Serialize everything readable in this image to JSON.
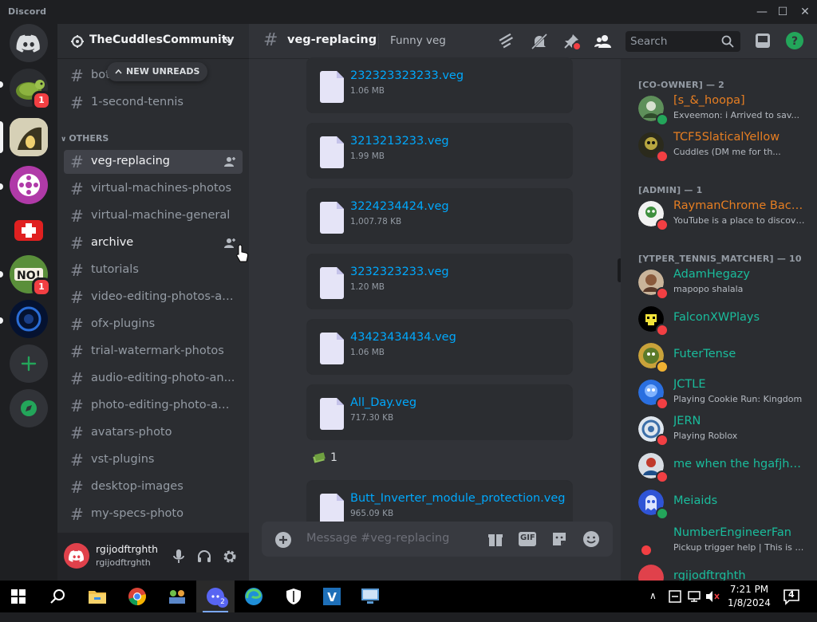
{
  "app": {
    "title": "Discord"
  },
  "window_controls": {
    "minimize": "—",
    "maximize": "☐",
    "close": "✕"
  },
  "servers": [
    {
      "name": "turtle-server",
      "badge": "1"
    },
    {
      "name": "selected-server"
    },
    {
      "name": "video-server"
    },
    {
      "name": "red-server"
    },
    {
      "name": "no-server",
      "badge": "1"
    },
    {
      "name": "space-server"
    }
  ],
  "guild": {
    "name": "TheCuddlesCommunity"
  },
  "new_unreads": "NEW UNREADS",
  "channels_top": [
    {
      "name": "bot"
    },
    {
      "name": "1-second-tennis"
    }
  ],
  "category_others": "OTHERS",
  "channels": [
    {
      "name": "veg-replacing"
    },
    {
      "name": "virtual-machines-photos"
    },
    {
      "name": "virtual-machine-general"
    },
    {
      "name": "archive"
    },
    {
      "name": "tutorials"
    },
    {
      "name": "video-editing-photos-an..."
    },
    {
      "name": "ofx-plugins"
    },
    {
      "name": "trial-watermark-photos"
    },
    {
      "name": "audio-editing-photo-an..."
    },
    {
      "name": "photo-editing-photo-an..."
    },
    {
      "name": "avatars-photo"
    },
    {
      "name": "vst-plugins"
    },
    {
      "name": "desktop-images"
    },
    {
      "name": "my-specs-photo"
    }
  ],
  "user": {
    "display": "rgijodftrghth",
    "username": "rgijodftrghth"
  },
  "chat_header": {
    "channel": "veg-replacing",
    "topic": "Funny veg",
    "search_placeholder": "Search"
  },
  "files": [
    {
      "name": "232323323233.veg",
      "size": "1.06 MB"
    },
    {
      "name": "3213213233.veg",
      "size": "1.99 MB"
    },
    {
      "name": "3224234424.veg",
      "size": "1,007.78 KB"
    },
    {
      "name": "3232323233.veg",
      "size": "1.20 MB"
    },
    {
      "name": "43423434434.veg",
      "size": "1.06 MB"
    },
    {
      "name": "All_Day.veg",
      "size": "717.30 KB"
    },
    {
      "name": "Butt_Inverter_module_protection.veg",
      "size": "965.09 KB"
    }
  ],
  "reaction": {
    "count": "1"
  },
  "composer": {
    "placeholder": "Message #veg-replacing",
    "gif": "GIF"
  },
  "member_groups": [
    {
      "title": "[CO-OWNER] — 2"
    },
    {
      "title": "[ADMIN] — 1"
    },
    {
      "title": "[YTPER_TENNIS_MATCHER] — 10"
    }
  ],
  "members": [
    {
      "name": "[s_&_hoopa]",
      "sub": "Exveemon: i Arrived to sav...",
      "color": "#e67e22"
    },
    {
      "name": "TCF5SlaticalYellow",
      "sub": "Cuddles (DM me for th...",
      "color": "#e67e22"
    },
    {
      "name": "RaymanChrome Back...",
      "sub": "YouTube is a place to discover...",
      "color": "#e67e22"
    },
    {
      "name": "AdamHegazy",
      "sub": "mapopo shalala",
      "color": "#1abc9c"
    },
    {
      "name": "FalconXWPlays",
      "color": "#1abc9c"
    },
    {
      "name": "FuterTense",
      "color": "#1abc9c"
    },
    {
      "name": "JCTLE",
      "sub": "Playing Cookie Run: Kingdom",
      "color": "#1abc9c"
    },
    {
      "name": "JERN",
      "sub": "Playing Roblox",
      "color": "#1abc9c"
    },
    {
      "name": "me when the hgafjhgf...",
      "color": "#1abc9c"
    },
    {
      "name": "Meiaids",
      "color": "#1abc9c"
    },
    {
      "name": "NumberEngineerFan",
      "sub": "Pickup trigger help | This is th...",
      "color": "#1abc9c"
    },
    {
      "name": "rgijodftrghth",
      "color": "#1abc9c"
    }
  ],
  "taskbar": {
    "time": "7:21 PM",
    "date": "1/8/2024",
    "notifications": "4",
    "discord_badge": "2"
  }
}
